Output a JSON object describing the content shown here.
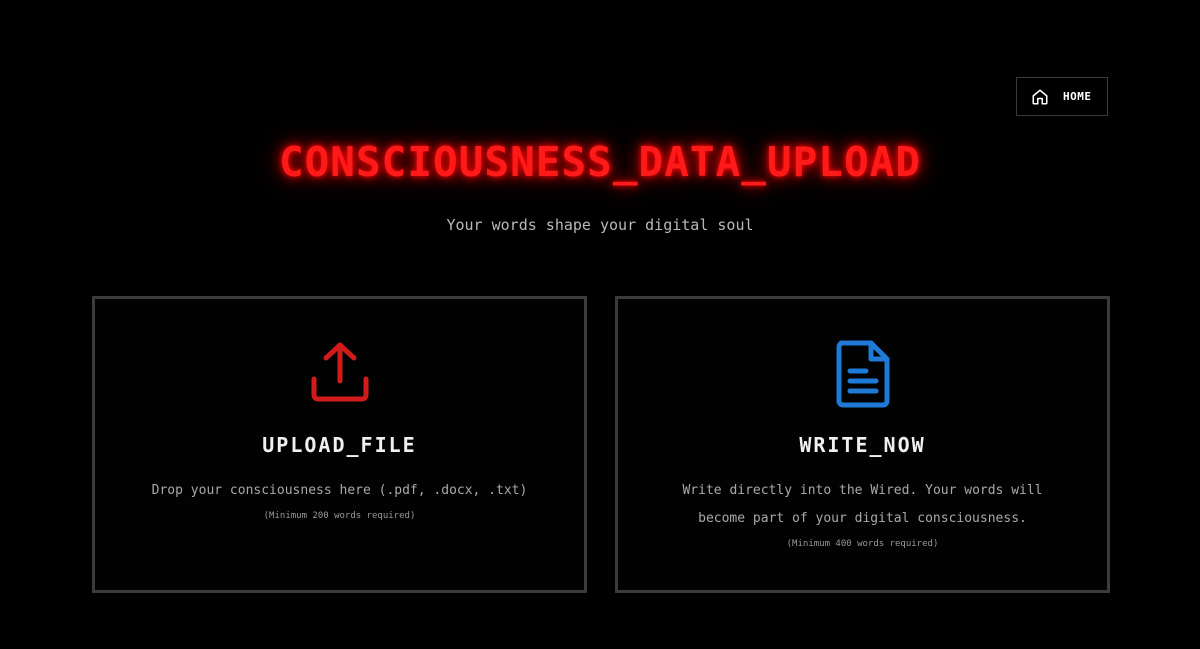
{
  "nav": {
    "home_label": "HOME",
    "home_icon": "home-icon"
  },
  "header": {
    "title": "CONSCIOUSNESS_DATA_UPLOAD",
    "subtitle": "Your words shape your digital soul"
  },
  "cards": [
    {
      "icon": "upload-icon",
      "title": "UPLOAD_FILE",
      "description": "Drop your consciousness here (.pdf, .docx, .txt)",
      "note": "(Minimum 200 words required)"
    },
    {
      "icon": "document-icon",
      "title": "WRITE_NOW",
      "description": "Write directly into the Wired. Your words will become part of your digital consciousness.",
      "note": "(Minimum 400 words required)"
    }
  ],
  "colors": {
    "background": "#000000",
    "title_red": "#ff1a1a",
    "upload_icon_red": "#d11b1b",
    "document_icon_blue": "#1e7ad6",
    "border_gray": "#3b3b3b"
  }
}
